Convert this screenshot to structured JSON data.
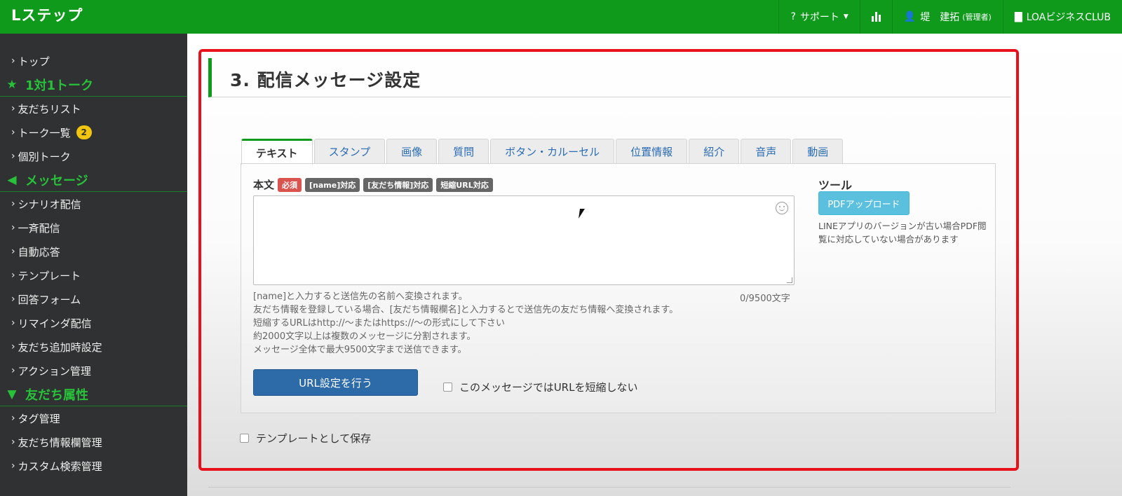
{
  "app": {
    "logo": "Lステップ"
  },
  "header": {
    "support_label": "サポート",
    "user_name": "堤　建拓",
    "user_role": "(管理者)",
    "account_label": "LOAビジネスCLUB"
  },
  "sidebar": {
    "top": "トップ",
    "section1": "1対1トーク",
    "friends_list": "友だちリスト",
    "talk_list": "トーク一覧",
    "talk_badge": "2",
    "individual_talk": "個別トーク",
    "section2": "メッセージ",
    "scenario": "シナリオ配信",
    "broadcast": "一斉配信",
    "auto_reply": "自動応答",
    "template": "テンプレート",
    "answer_form": "回答フォーム",
    "remind": "リマインダ配信",
    "friend_add_setting": "友だち追加時設定",
    "action": "アクション管理",
    "section3": "友だち属性",
    "tag_manage": "タグ管理",
    "friend_info_manage": "友だち情報欄管理",
    "custom_search": "カスタム検索管理"
  },
  "main": {
    "section_title": "3. 配信メッセージ設定",
    "tabs": [
      "テキスト",
      "スタンプ",
      "画像",
      "質問",
      "ボタン・カルーセル",
      "位置情報",
      "紹介",
      "音声",
      "動画"
    ],
    "body_label": "本文",
    "tag_required": "必須",
    "tag_name": "[name]対応",
    "tag_friend_info": "[友だち情報]対応",
    "tag_short_url": "短縮URL対応",
    "counter": "0/9500文字",
    "help_lines": [
      "[name]と入力すると送信先の名前へ変換されます。",
      "友だち情報を登録している場合、[友だち情報欄名]と入力するとで送信先の友だち情報へ変換されます。",
      "短縮するURLはhttp://〜またはhttps://〜の形式にして下さい",
      "約2000文字以上は複数のメッセージに分割されます。",
      "メッセージ全体で最大9500文字まで送信できます。"
    ],
    "url_button": "URL設定を行う",
    "no_shorten_label": "このメッセージではURLを短縮しない",
    "save_template_label": "テンプレートとして保存",
    "tool_title": "ツール",
    "pdf_button": "PDFアップロード",
    "tool_note": "LINEアプリのバージョンが古い場合PDF閲覧に対応していない場合があります"
  },
  "colors": {
    "brand": "#0f9a1c",
    "highlight": "#e8101b",
    "primary": "#2c6aa8",
    "info": "#5bc0de"
  }
}
